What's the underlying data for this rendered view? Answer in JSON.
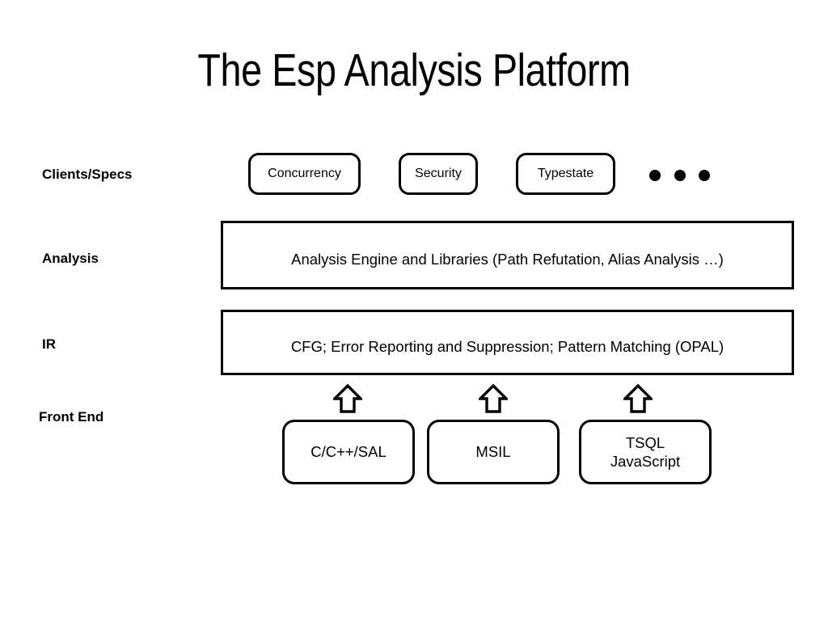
{
  "slide": {
    "title": "The Esp Analysis Platform",
    "background_color": "#ffffff",
    "stroke_color": "#000000",
    "text_color": "#000000"
  },
  "row_labels": {
    "clients_specs": "Clients/Specs",
    "analysis": "Analysis",
    "ir": "IR",
    "front_end": "Front End"
  },
  "clients_row": {
    "boxes": [
      {
        "label": "Concurrency"
      },
      {
        "label": "Security"
      },
      {
        "label": "Typestate"
      }
    ],
    "ellipsis": "• • •",
    "ellipsis_dot_count": 3
  },
  "analysis_row": {
    "band_text": "Analysis Engine and Libraries (Path Refutation,  Alias Analysis …)"
  },
  "ir_row": {
    "band_text": "CFG;  Error Reporting and Suppression;  Pattern Matching (OPAL)"
  },
  "front_end_row": {
    "boxes": [
      {
        "label": "C/C++/SAL"
      },
      {
        "label": "MSIL"
      },
      {
        "label": "TSQL\nJavaScript"
      }
    ],
    "arrows": [
      {
        "direction": "up"
      },
      {
        "direction": "up"
      },
      {
        "direction": "up"
      }
    ]
  }
}
